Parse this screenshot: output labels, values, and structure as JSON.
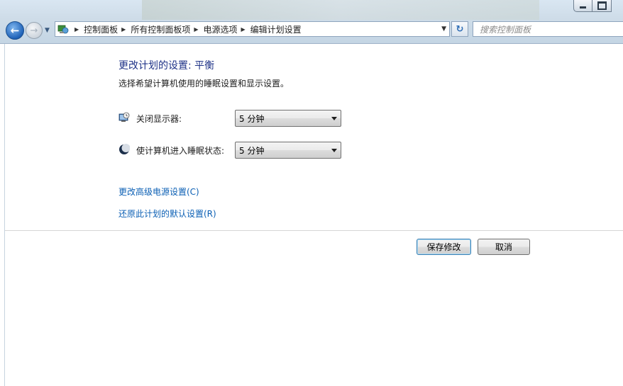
{
  "address_bar": {
    "crumbs": [
      "控制面板",
      "所有控制面板项",
      "电源选项",
      "编辑计划设置"
    ]
  },
  "search": {
    "placeholder": "搜索控制面板"
  },
  "page": {
    "title": "更改计划的设置: 平衡",
    "subtitle": "选择希望计算机使用的睡眠设置和显示设置。"
  },
  "settings": [
    {
      "label": "关闭显示器:",
      "value": "5 分钟",
      "icon": "monitor-clock-icon"
    },
    {
      "label": "使计算机进入睡眠状态:",
      "value": "5 分钟",
      "icon": "moon-icon"
    }
  ],
  "links": {
    "advanced": "更改高级电源设置(C)",
    "restore": "还原此计划的默认设置(R)"
  },
  "buttons": {
    "save": "保存修改",
    "cancel": "取消"
  },
  "colors": {
    "title": "#1e3287",
    "link": "#0b5fb4"
  }
}
